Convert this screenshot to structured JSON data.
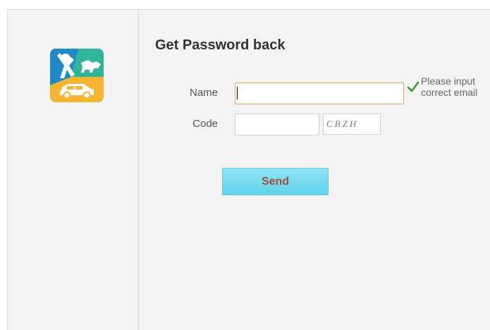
{
  "page": {
    "title": "Get Password back"
  },
  "form": {
    "name_label": "Name",
    "name_value": "",
    "code_label": "Code",
    "code_value": "",
    "captcha_text": "CBZH",
    "hint": "Please input correct email",
    "send_label": "Send"
  },
  "icons": {
    "logo": "app-logo-icon",
    "validation": "check-icon"
  },
  "colors": {
    "accent_button": "#63d2ed",
    "button_text": "#a0503a",
    "input_focus_border": "#e8a74a",
    "check_green": "#3a9b2c"
  }
}
